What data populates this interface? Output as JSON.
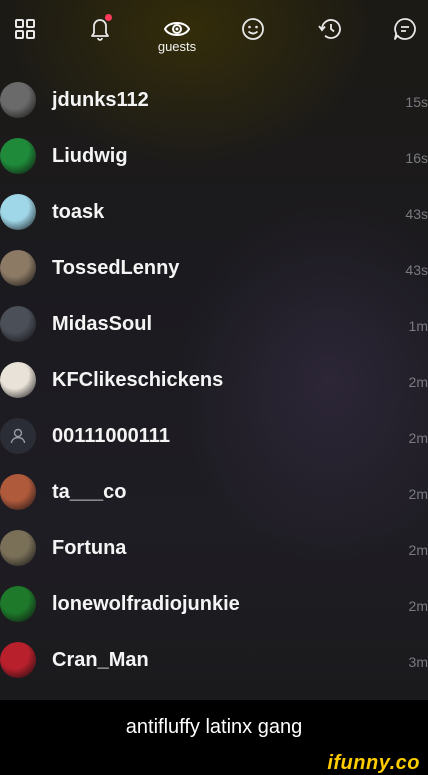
{
  "header": {
    "active_tab_label": "guests",
    "icons": [
      "grid-icon",
      "bell-icon",
      "eye-icon",
      "smiley-icon",
      "history-icon",
      "chat-icon"
    ],
    "notification_color": "#ff3b5c"
  },
  "guests": [
    {
      "name": "jdunks112",
      "time": "15s",
      "avatar": "#6a6a6a"
    },
    {
      "name": "Liudwig",
      "time": "16s",
      "avatar": "#1f8a3a"
    },
    {
      "name": "toask",
      "time": "43s",
      "avatar": "#9fd6e8"
    },
    {
      "name": "TossedLenny",
      "time": "43s",
      "avatar": "#8c7a64"
    },
    {
      "name": "MidasSoul",
      "time": "1m",
      "avatar": "#4a4f58"
    },
    {
      "name": "KFClikeschickens",
      "time": "2m",
      "avatar": "#e8e2d8"
    },
    {
      "name": "00111000111",
      "time": "2m",
      "avatar": "#2a2d36"
    },
    {
      "name": "ta___co",
      "time": "2m",
      "avatar": "#b05a3c"
    },
    {
      "name": "Fortuna",
      "time": "2m",
      "avatar": "#7a7058"
    },
    {
      "name": "lonewolfradiojunkie",
      "time": "2m",
      "avatar": "#1e7a2a"
    },
    {
      "name": "Cran_Man",
      "time": "3m",
      "avatar": "#b8202c"
    }
  ],
  "caption": "antifluffy latinx gang",
  "watermark": "ifunny.co",
  "colors": {
    "accent": "#ffcc00",
    "muted_text": "#7a7a80"
  }
}
